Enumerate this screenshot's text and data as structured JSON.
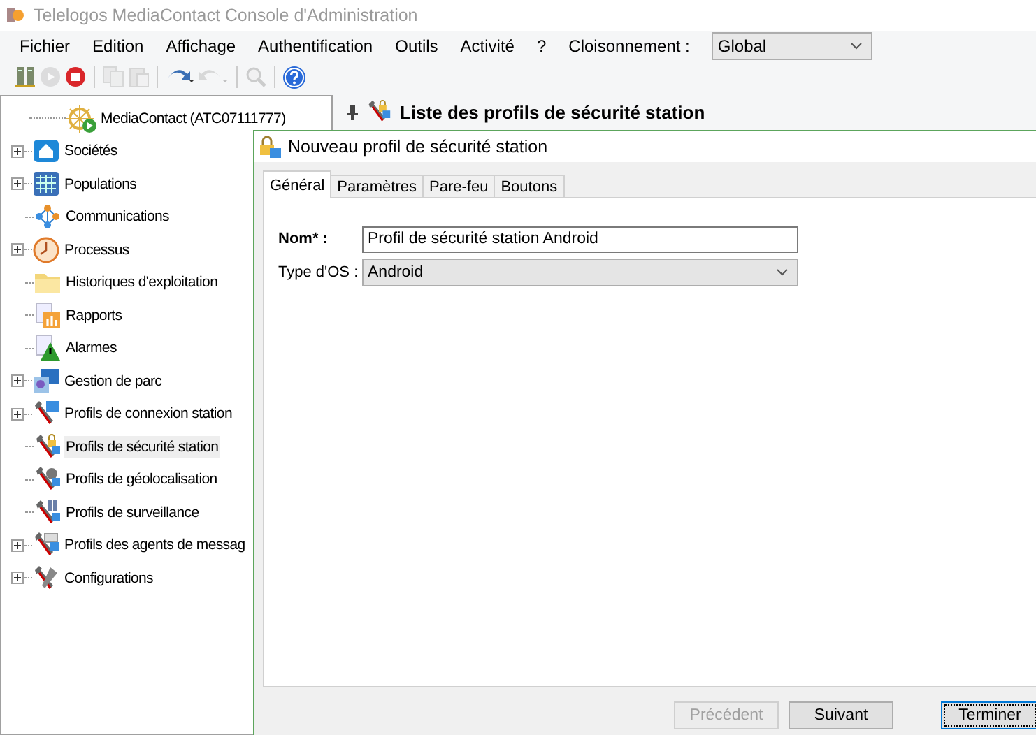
{
  "window": {
    "title": "Telelogos MediaContact Console d'Administration"
  },
  "menu": [
    "Fichier",
    "Edition",
    "Affichage",
    "Authentification",
    "Outils",
    "Activité",
    "?"
  ],
  "partition": {
    "label": "Cloisonnement :",
    "value": "Global"
  },
  "toolbar": [
    {
      "disabled": false
    },
    {
      "disabled": true
    },
    {
      "disabled": false
    },
    {
      "disabled": true
    },
    {
      "disabled": true
    },
    {
      "disabled": false
    },
    {
      "disabled": true
    },
    {
      "disabled": true
    },
    {
      "disabled": false
    }
  ],
  "tree": {
    "root": "MediaContact (ATC07111777)",
    "items": [
      {
        "label": "Sociétés",
        "expandable": true,
        "selected": false
      },
      {
        "label": "Populations",
        "expandable": true,
        "selected": false
      },
      {
        "label": "Communications",
        "expandable": false,
        "selected": false
      },
      {
        "label": "Processus",
        "expandable": true,
        "selected": false
      },
      {
        "label": "Historiques d'exploitation",
        "expandable": false,
        "selected": false
      },
      {
        "label": "Rapports",
        "expandable": false,
        "selected": false
      },
      {
        "label": "Alarmes",
        "expandable": false,
        "selected": false
      },
      {
        "label": "Gestion de parc",
        "expandable": true,
        "selected": false
      },
      {
        "label": "Profils de connexion station",
        "expandable": true,
        "selected": false
      },
      {
        "label": "Profils de sécurité station",
        "expandable": false,
        "selected": true
      },
      {
        "label": "Profils de géolocalisation",
        "expandable": false,
        "selected": false
      },
      {
        "label": "Profils de surveillance",
        "expandable": false,
        "selected": false
      },
      {
        "label": "Profils des agents de messag",
        "expandable": true,
        "selected": false
      },
      {
        "label": "Configurations",
        "expandable": true,
        "selected": false
      }
    ]
  },
  "list_panel": {
    "title": "Liste des profils de sécurité station"
  },
  "dialog": {
    "title": "Nouveau profil de sécurité station",
    "tabs": [
      {
        "label": "Général",
        "selected": true
      },
      {
        "label": "Paramètres",
        "selected": false
      },
      {
        "label": "Pare-feu",
        "selected": false
      },
      {
        "label": "Boutons",
        "selected": false
      }
    ],
    "fields": [
      {
        "kind": "text",
        "label": "Nom* :",
        "required": true,
        "value": "Profil de sécurité station Android"
      },
      {
        "kind": "select",
        "label": "Type d'OS :",
        "required": false,
        "value": "Android"
      }
    ],
    "buttons": [
      {
        "label": "Précédent",
        "disabled": true,
        "default": false
      },
      {
        "label": "Suivant",
        "disabled": false,
        "default": false
      },
      {
        "label": "Terminer",
        "disabled": false,
        "default": true
      }
    ]
  }
}
